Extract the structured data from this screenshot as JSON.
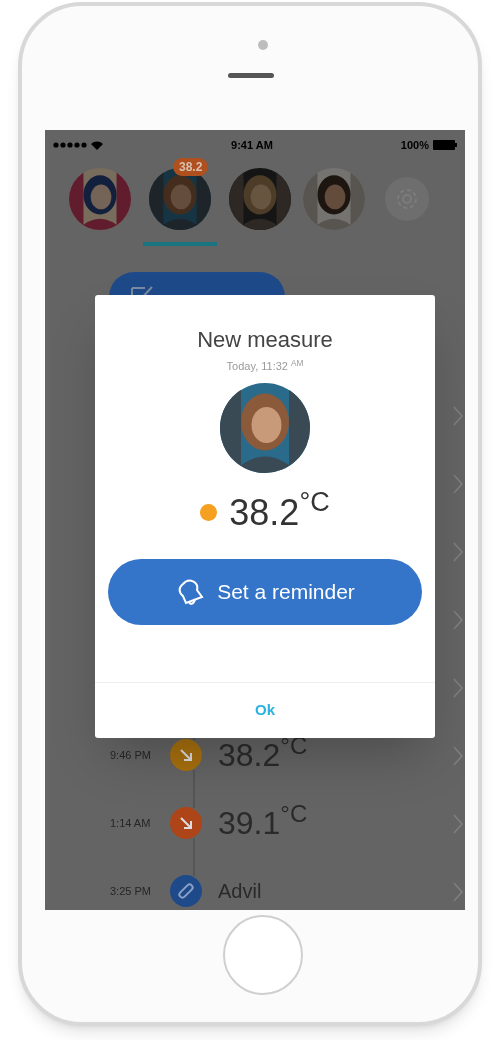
{
  "status_bar": {
    "time": "9:41 AM",
    "battery": "100%"
  },
  "profiles": [
    {
      "kind": "picture",
      "selected": false
    },
    {
      "kind": "picture",
      "selected": true,
      "badge": "38.2"
    },
    {
      "kind": "picture",
      "selected": false
    },
    {
      "kind": "picture",
      "selected": false
    },
    {
      "kind": "settings",
      "selected": false
    }
  ],
  "timeline": [
    {
      "kind": "covered"
    },
    {
      "kind": "covered"
    },
    {
      "kind": "covered"
    },
    {
      "kind": "covered"
    },
    {
      "kind": "covered"
    },
    {
      "kind": "temperature",
      "time": "9:46 PM",
      "value": "38.2",
      "unit": "°C",
      "color": "#a8700e"
    },
    {
      "kind": "temperature",
      "time": "1:14 AM",
      "value": "39.1",
      "unit": "°C",
      "color": "#ad4518"
    },
    {
      "kind": "medication",
      "time": "3:25 PM",
      "label": "Advil",
      "color": "#1f4a8a"
    }
  ],
  "dialog": {
    "title": "New measure",
    "time": "Today, 11:32 $^{AM}$",
    "value": "38.2",
    "unit": "°C",
    "color": "#f5a020",
    "reminder_button": "Set a reminder",
    "ok_button": "Ok"
  }
}
